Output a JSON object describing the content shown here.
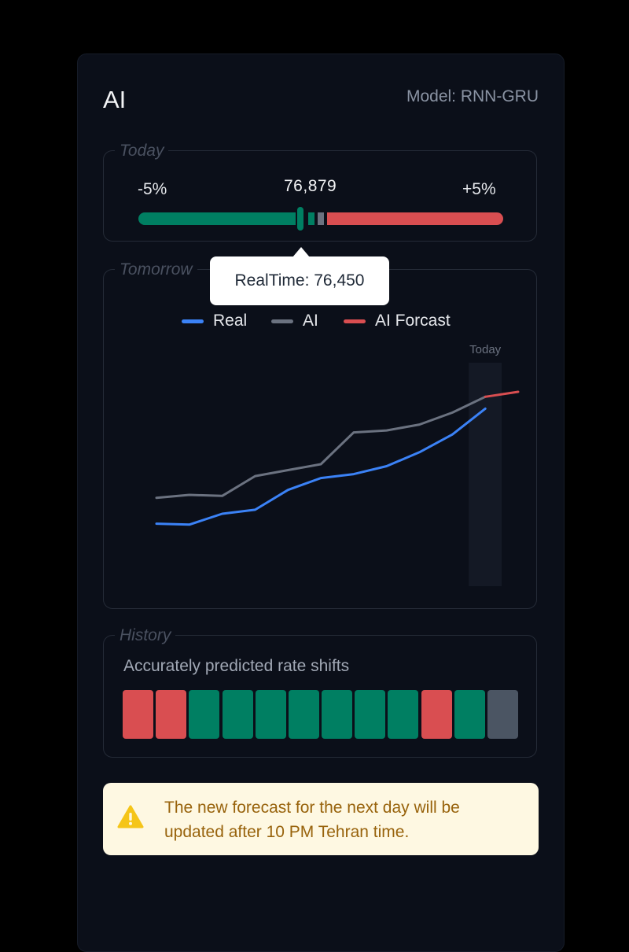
{
  "panel": {
    "title": "AI",
    "model": "Model: RNN-GRU"
  },
  "today": {
    "legend": "Today",
    "min_label": "-5%",
    "max_label": "+5%",
    "value": "76,879",
    "tooltip": "RealTime: 76,450",
    "colors": {
      "negative": "#007f62",
      "positive": "#d94e51",
      "marker": "#6b7280"
    }
  },
  "tomorrow": {
    "legend": "Tomorrow"
  },
  "chart_data": {
    "type": "line",
    "title": "",
    "xlabel": "",
    "ylabel": "",
    "annotation": "Today",
    "grid": false,
    "legend_position": "top-center",
    "x": [
      1,
      2,
      3,
      4,
      5,
      6,
      7,
      8,
      9,
      10,
      11,
      12
    ],
    "ylim": [
      0,
      100
    ],
    "series": [
      {
        "name": "Real",
        "color": "#3b82f6",
        "x": [
          1,
          2,
          3,
          4,
          5,
          6,
          7,
          8,
          9,
          10,
          11
        ],
        "values": [
          22,
          21.5,
          27,
          29,
          39,
          45,
          47,
          51,
          58,
          67,
          80
        ]
      },
      {
        "name": "AI",
        "color": "#6b7280",
        "x": [
          1,
          2,
          3,
          4,
          5,
          6,
          7,
          8,
          9,
          10,
          11
        ],
        "values": [
          35,
          36.5,
          36,
          46,
          49,
          52,
          68,
          69,
          72,
          78,
          86
        ]
      },
      {
        "name": "AI Forcast",
        "color": "#d94e51",
        "x": [
          11,
          12
        ],
        "values": [
          86,
          88.5
        ]
      }
    ],
    "highlight_x": 11
  },
  "history": {
    "legend": "History",
    "caption": "Accurately predicted rate shifts",
    "cells": [
      "miss",
      "miss",
      "hit",
      "hit",
      "hit",
      "hit",
      "hit",
      "hit",
      "hit",
      "miss",
      "hit",
      "pending"
    ],
    "colors": {
      "hit": "#007f62",
      "miss": "#d94e51",
      "pending": "#4b5563"
    }
  },
  "notice": {
    "line1": "The new forecast for the next day will be",
    "line2": "updated after 10 PM Tehran time."
  }
}
